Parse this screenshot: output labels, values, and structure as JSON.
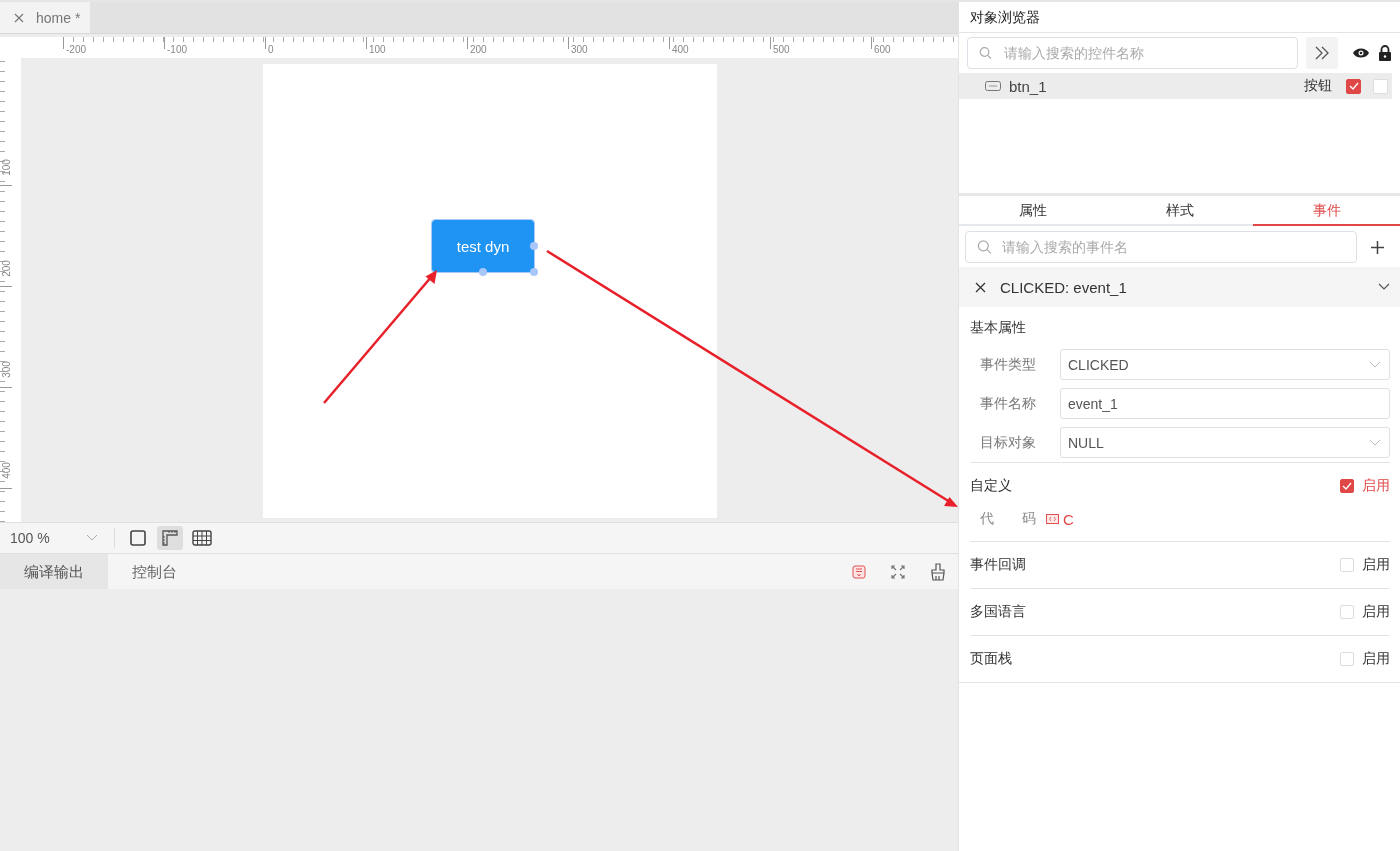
{
  "tabs": [
    {
      "label": "home *",
      "selected": true
    }
  ],
  "ruler": {
    "x_labels": [
      "-200",
      "-100",
      "0",
      "100",
      "200",
      "300",
      "400",
      "500",
      "600"
    ],
    "y_labels": [
      "100",
      "200",
      "300",
      "400"
    ]
  },
  "canvas": {
    "widget": {
      "label": "test dyn",
      "selected": true
    }
  },
  "toolbar": {
    "zoom": "100 %",
    "tools": [
      {
        "kind": "frame",
        "selected": false
      },
      {
        "kind": "ruler",
        "selected": true
      },
      {
        "kind": "grid",
        "selected": false
      }
    ]
  },
  "output_tabs": [
    {
      "label": "编译输出",
      "selected": true
    },
    {
      "label": "控制台",
      "selected": false
    }
  ],
  "object_browser": {
    "title": "对象浏览器",
    "search": {
      "placeholder": "请输入搜索的控件名称"
    },
    "items": [
      {
        "name": "btn_1",
        "type": "按钮",
        "visible": true,
        "locked": false,
        "selected": true
      }
    ]
  },
  "inspector": {
    "tabs": [
      {
        "label": "属性",
        "selected": false
      },
      {
        "label": "样式",
        "selected": false
      },
      {
        "label": "事件",
        "selected": true
      }
    ],
    "search": {
      "placeholder": "请输入搜索的事件名"
    },
    "event": {
      "title": "CLICKED: event_1",
      "expanded": true,
      "section": "基本属性",
      "fields": [
        {
          "label": "事件类型",
          "kind": "select",
          "value": "CLICKED"
        },
        {
          "label": "事件名称",
          "kind": "input",
          "value": "event_1"
        },
        {
          "label": "目标对象",
          "kind": "select",
          "value": "NULL"
        }
      ],
      "options": [
        {
          "label": "自定义",
          "checked": true,
          "check_label": "启用",
          "code": {
            "label_parts": [
              "代",
              "码"
            ],
            "value": "C"
          }
        },
        {
          "label": "事件回调",
          "checked": false,
          "check_label": "启用"
        },
        {
          "label": "多国语言",
          "checked": false,
          "check_label": "启用"
        },
        {
          "label": "页面栈",
          "checked": false,
          "check_label": "启用"
        }
      ]
    }
  }
}
